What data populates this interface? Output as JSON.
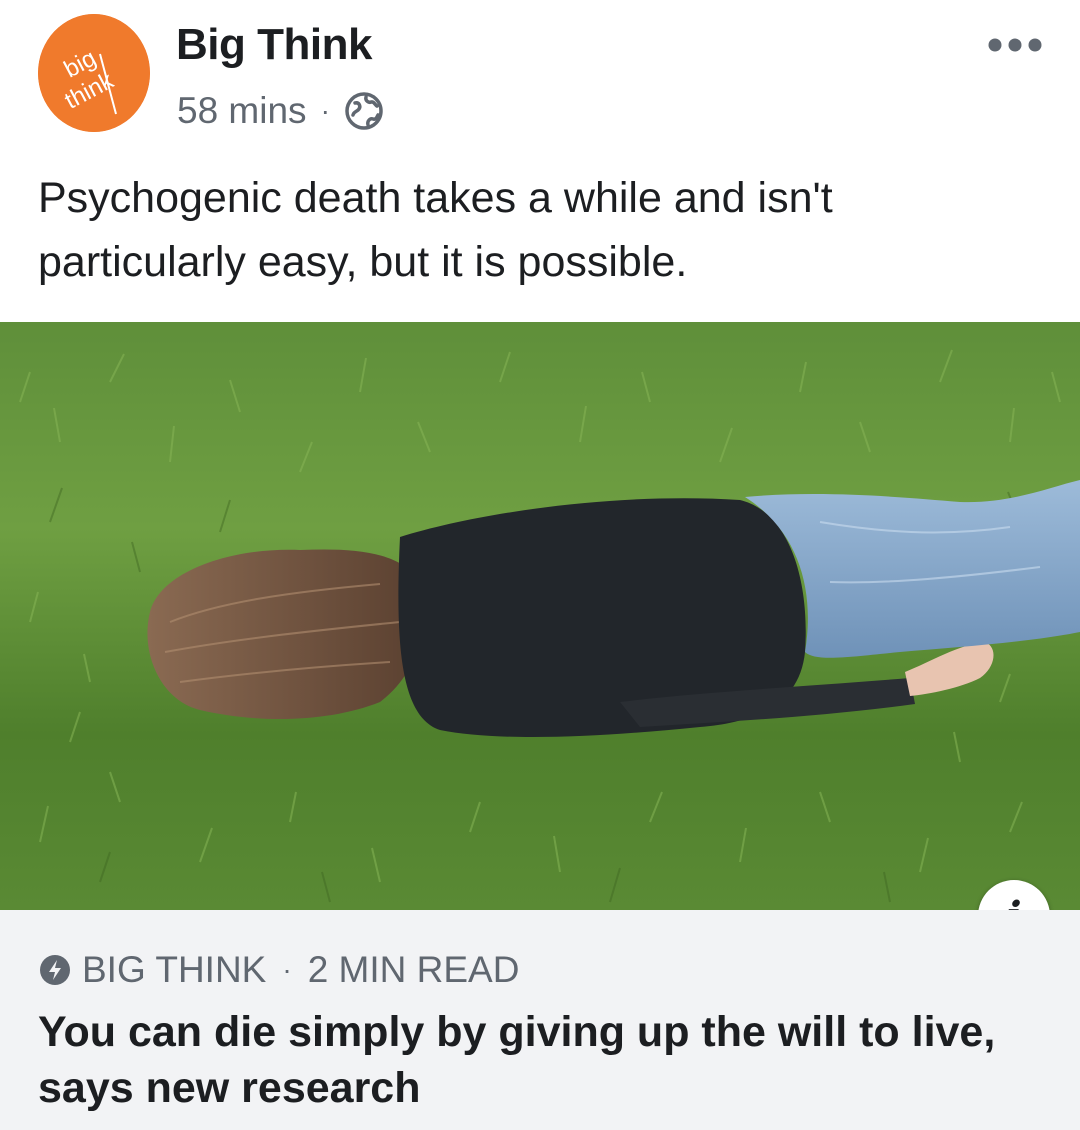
{
  "post": {
    "page_name": "Big Think",
    "avatar_text_top": "big",
    "avatar_text_bottom": "think",
    "time_ago": "58 mins",
    "separator": "·",
    "privacy_icon": "globe-icon",
    "menu_icon": "more-horizontal-icon",
    "caption": "Psychogenic death takes a while and isn't particularly easy, but it is possible."
  },
  "link": {
    "image_description_icon": "photo",
    "info_label": "i",
    "source_icon": "verified-link-icon",
    "source": "BIG THINK",
    "separator": "·",
    "read_time": "2 MIN READ",
    "headline": "You can die simply by giving up the will to live, says new research"
  },
  "colors": {
    "brand_orange": "#f07a2c",
    "text_primary": "#1c1e21",
    "text_secondary": "#606770",
    "link_bar_bg": "#f2f3f5"
  }
}
